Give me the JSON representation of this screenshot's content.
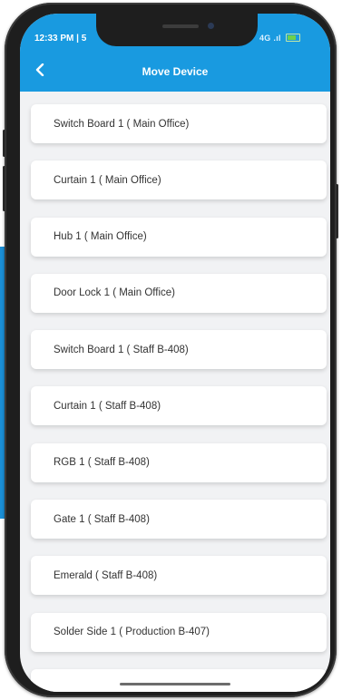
{
  "status_bar": {
    "time": "12:33 PM | 5",
    "right_text": "4G .ıl",
    "battery_icon": "battery-icon",
    "signal_icon": "signal-icon"
  },
  "header": {
    "title": "Move Device",
    "back_icon": "chevron-left-icon",
    "color": "#199ae0"
  },
  "devices": [
    {
      "label": "Switch Board 1 ( Main Office)"
    },
    {
      "label": "Curtain 1 ( Main Office)"
    },
    {
      "label": "Hub 1 ( Main Office)"
    },
    {
      "label": "Door Lock 1 ( Main Office)"
    },
    {
      "label": "Switch Board 1 ( Staff B-408)"
    },
    {
      "label": "Curtain 1 ( Staff B-408)"
    },
    {
      "label": "RGB 1 ( Staff B-408)"
    },
    {
      "label": "Gate 1 ( Staff B-408)"
    },
    {
      "label": "Emerald ( Staff B-408)"
    },
    {
      "label": "Solder Side 1 ( Production B-407)"
    }
  ]
}
